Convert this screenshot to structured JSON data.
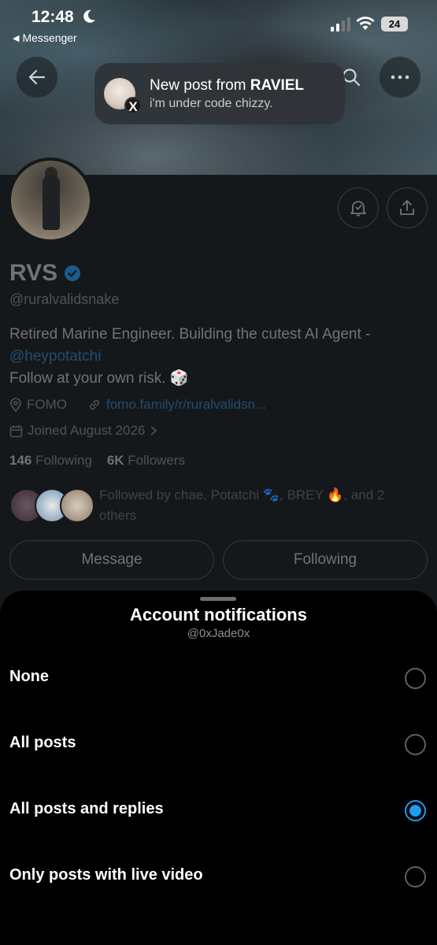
{
  "status_bar": {
    "time": "12:48",
    "back_app": "Messenger",
    "battery": "24"
  },
  "notification": {
    "title_prefix": "New post from",
    "title_name": "RAVIEL",
    "body": "i'm under code chizzy.",
    "badge": "X"
  },
  "profile": {
    "name": "RVS",
    "handle": "@ruralvalidsnake",
    "bio_line1": "Retired Marine Engineer. Building the cutest AI Agent -",
    "bio_mention": "@heypotatchi",
    "bio_line2": "Follow at your own risk. 🎲",
    "location": "FOMO",
    "website": "fomo.family/r/ruralvalidsn...",
    "joined": "Joined August 2026",
    "following_count": "146",
    "following_label": "Following",
    "followers_count": "6K",
    "followers_label": "Followers",
    "followed_by": "Followed by chae, Potatchi 🐾, BREY 🔥, and 2 others",
    "message_button": "Message",
    "following_button": "Following"
  },
  "sheet": {
    "title": "Account notifications",
    "subtitle": "@0xJade0x",
    "options": [
      {
        "label": "None",
        "selected": false
      },
      {
        "label": "All posts",
        "selected": false
      },
      {
        "label": "All posts and replies",
        "selected": true
      },
      {
        "label": "Only posts with live video",
        "selected": false
      }
    ]
  },
  "colors": {
    "accent": "#1d9bf0",
    "sheet_bg": "#000000"
  }
}
